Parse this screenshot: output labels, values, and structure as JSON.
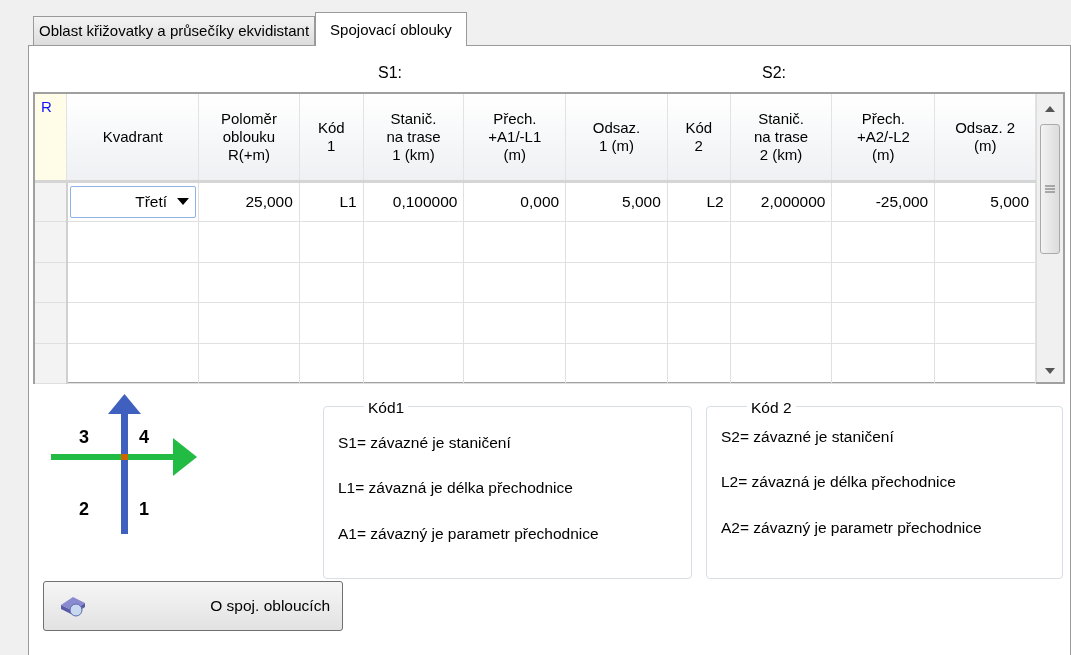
{
  "tabs": [
    {
      "label": "Oblast křižovatky a průsečíky ekvidistant",
      "selected": false
    },
    {
      "label": "Spojovací oblouky",
      "selected": true
    }
  ],
  "group_labels": [
    "S1:",
    "S2:"
  ],
  "table": {
    "corner": "R",
    "columns": [
      "Kvadrant",
      "Poloměr\noblouku\nR(+m)",
      "Kód\n1",
      "Stanič.\nna trase\n1 (km)",
      "Přech.\n+A1/-L1\n(m)",
      "Odsaz.\n1 (m)",
      "Kód\n2",
      "Stanič.\nna trase\n2 (km)",
      "Přech.\n+A2/-L2\n(m)",
      "Odsaz. 2\n(m)"
    ],
    "rows": [
      {
        "cells": [
          "Třetí",
          "25,000",
          "L1",
          "0,100000",
          "0,000",
          "5,000",
          "L2",
          "2,000000",
          "-25,000",
          "5,000"
        ]
      }
    ]
  },
  "quadrant_labels": [
    "3",
    "4",
    "2",
    "1"
  ],
  "legends": [
    {
      "title": "Kód1",
      "lines": [
        "S1= závazné je staničení",
        "L1= závazná je délka přechodnice",
        "A1= závazný je parametr přechodnice"
      ]
    },
    {
      "title": "Kód 2",
      "lines": [
        "S2= závazné je staničení",
        "L2= závazná je délka přechodnice",
        "A2= závazný je parametr přechodnice"
      ]
    }
  ],
  "help_button": {
    "label": "O spoj. obloucích"
  }
}
